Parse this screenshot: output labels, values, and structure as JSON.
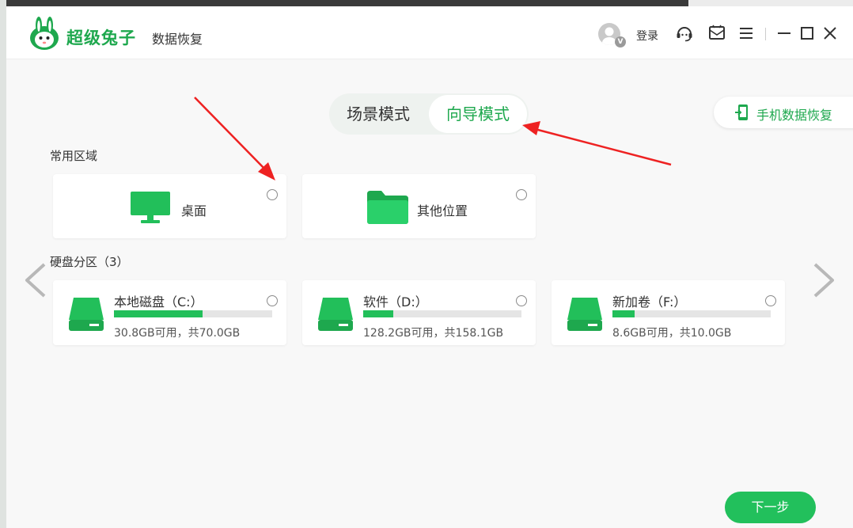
{
  "app": {
    "name": "超级兔子",
    "subtitle": "数据恢复"
  },
  "header": {
    "login_label": "登录",
    "avatar_badge": "V"
  },
  "modes": {
    "scene_label": "场景模式",
    "guide_label": "向导模式",
    "active": "guide"
  },
  "phone_recovery_label": "手机数据恢复",
  "common_area": {
    "title": "常用区域",
    "items": [
      {
        "label": "桌面",
        "icon": "monitor-icon"
      },
      {
        "label": "其他位置",
        "icon": "folder-icon"
      }
    ]
  },
  "disk_section": {
    "title": "硬盘分区（3）",
    "drives": [
      {
        "name": "本地磁盘（C:）",
        "info": "30.8GB可用，共70.0GB",
        "used_fraction": 0.56
      },
      {
        "name": "软件（D:）",
        "info": "128.2GB可用，共158.1GB",
        "used_fraction": 0.19
      },
      {
        "name": "新加卷（F:）",
        "info": "8.6GB可用，共10.0GB",
        "used_fraction": 0.14
      }
    ]
  },
  "next_button_label": "下一步",
  "colors": {
    "brand_green": "#1ea84e",
    "bar_green": "#22bf5a",
    "annotation_red": "#ee2222"
  }
}
